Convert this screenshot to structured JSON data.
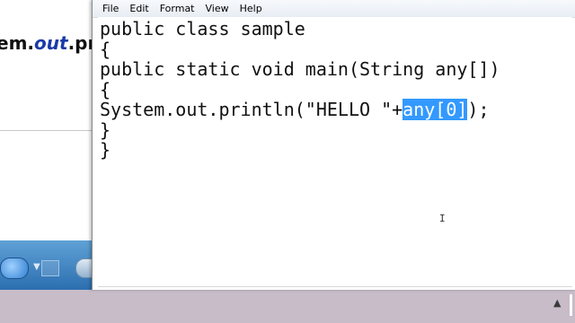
{
  "background_window": {
    "code_prefix": "em.",
    "code_keyword": "out",
    "code_suffix": ".pr"
  },
  "notepad": {
    "menu": [
      "File",
      "Edit",
      "Format",
      "View",
      "Help"
    ],
    "code": {
      "line1": "public class sample",
      "line2": "{",
      "line3": "public static void main(String any[])",
      "line4": "{",
      "line5_before": "System.out.println(\"HELLO \"+",
      "line5_selected": "any[0]",
      "line5_after": ");",
      "line6": "}",
      "line7": "}"
    },
    "selection_color": "#3399ff",
    "cursor_icon": "I"
  },
  "taskbar": {
    "tray_arrow": "▲",
    "dropdown_arrow": "▼"
  }
}
